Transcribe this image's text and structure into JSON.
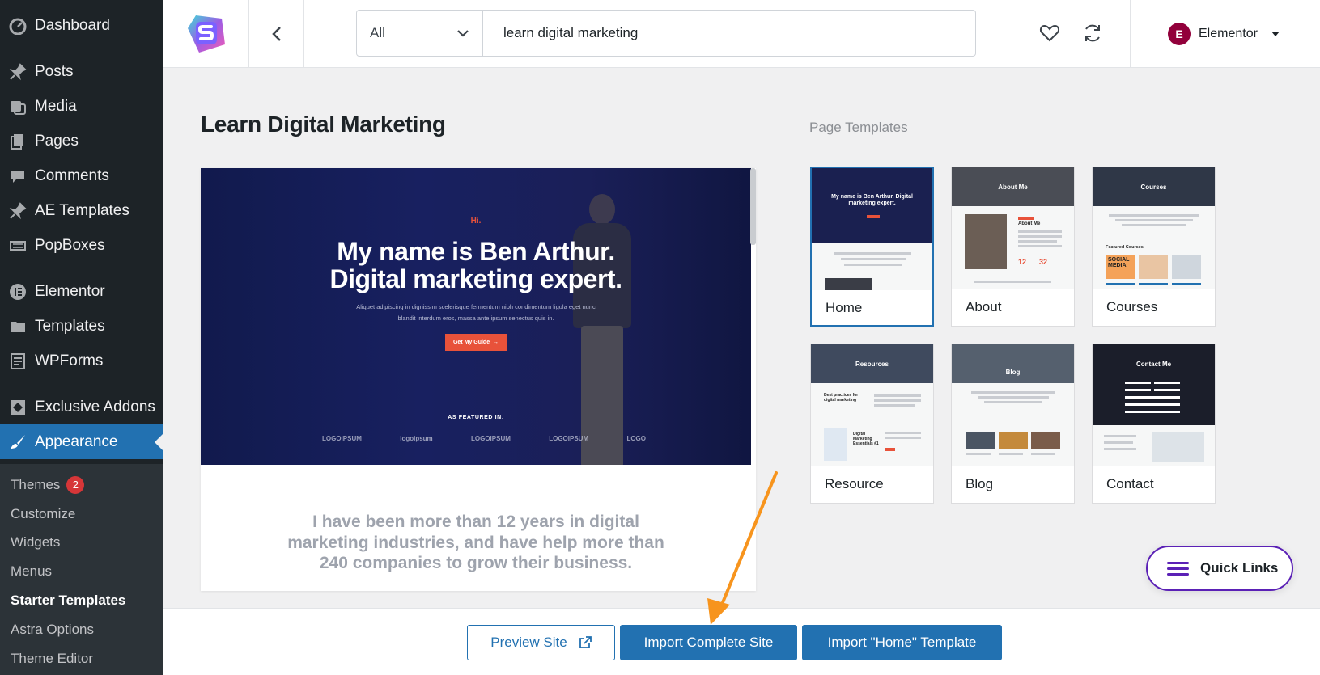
{
  "sidebar": {
    "menu": [
      {
        "label": "Dashboard",
        "icon": "dashboard-icon"
      },
      {
        "label": "Posts",
        "icon": "pin-icon"
      },
      {
        "label": "Media",
        "icon": "media-icon"
      },
      {
        "label": "Pages",
        "icon": "pages-icon"
      },
      {
        "label": "Comments",
        "icon": "comment-icon"
      },
      {
        "label": "AE Templates",
        "icon": "pin-icon"
      },
      {
        "label": "PopBoxes",
        "icon": "list-icon"
      },
      {
        "label": "Elementor",
        "icon": "elementor-icon"
      },
      {
        "label": "Templates",
        "icon": "folder-icon"
      },
      {
        "label": "WPForms",
        "icon": "form-icon"
      },
      {
        "label": "Exclusive Addons",
        "icon": "addons-icon"
      },
      {
        "label": "Appearance",
        "icon": "brush-icon"
      }
    ],
    "submenu": [
      {
        "label": "Themes",
        "badge": "2"
      },
      {
        "label": "Customize"
      },
      {
        "label": "Widgets"
      },
      {
        "label": "Menus"
      },
      {
        "label": "Starter Templates"
      },
      {
        "label": "Astra Options"
      },
      {
        "label": "Theme Editor"
      }
    ]
  },
  "topbar": {
    "filter_value": "All",
    "search_value": "learn digital marketing",
    "builder": "Elementor",
    "builder_initial": "E"
  },
  "main": {
    "title": "Learn Digital Marketing",
    "page_templates_label": "Page Templates",
    "preview": {
      "hi": "Hi.",
      "heading_line1": "My name is Ben Arthur.",
      "heading_line2": "Digital marketing expert.",
      "sub_line1": "Aliquet adipiscing in dignissim scelerisque fermentum nibh condimentum ligula eget nunc",
      "sub_line2": "blandit interdum eros, massa ante ipsum senectus quis in.",
      "button": "Get My Guide",
      "featured": "AS FEATURED IN:",
      "logos": [
        "LOGOIPSUM",
        "logoipsum",
        "LOGOIPSUM",
        "LOGOIPSUM",
        "LOGO"
      ],
      "body_text": "I have been more than 12 years in digital marketing industries, and have help more than 240 companies to grow their business."
    },
    "templates": [
      {
        "label": "Home",
        "thumb_title": "My name is Ben Arthur. Digital marketing expert."
      },
      {
        "label": "About",
        "thumb_title": "About Me"
      },
      {
        "label": "Courses",
        "thumb_title": "Courses",
        "tiles": "SOCIAL MEDIA"
      },
      {
        "label": "Resource",
        "thumb_title": "Resources",
        "headline": "Best practices for digital marketing",
        "book": "Digital Marketing Essentials #1"
      },
      {
        "label": "Blog",
        "thumb_title": "Blog"
      },
      {
        "label": "Contact",
        "thumb_title": "Contact Me"
      }
    ],
    "thumb_texts": {
      "about_heading": "About Me",
      "about_stats": [
        "12",
        "32"
      ],
      "courses_featured": "Featured Courses"
    }
  },
  "quick_links": "Quick Links",
  "footer": {
    "preview_label": "Preview Site",
    "import_label": "Import Complete Site",
    "import_home_label": "Import \"Home\" Template"
  },
  "colors": {
    "sidebar_bg": "#1d2327",
    "primary": "#2271b1",
    "accent_orange": "#f7941d",
    "quick_links_border": "#5b21b6"
  }
}
